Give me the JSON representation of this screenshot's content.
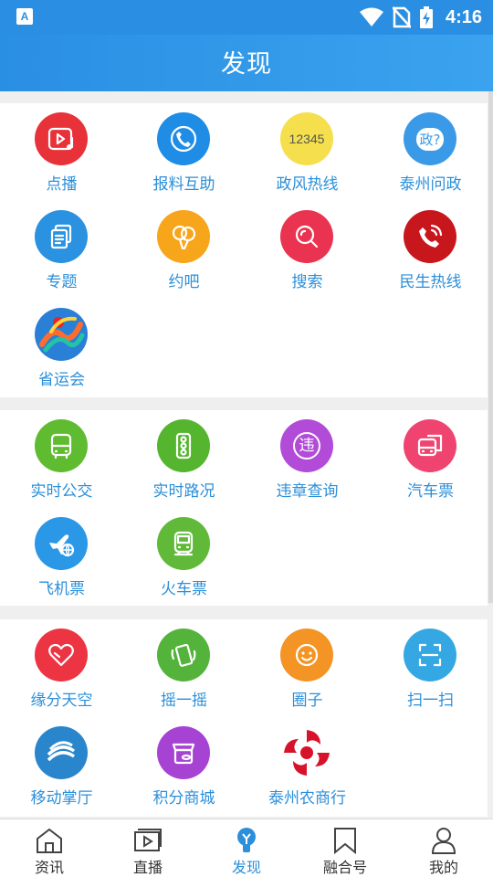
{
  "status_bar": {
    "time": "4:16",
    "app_badge": "A"
  },
  "header": {
    "title": "发现"
  },
  "sections": [
    {
      "items": [
        {
          "label": "点播",
          "icon": "video-music-icon",
          "color": "#e8323a"
        },
        {
          "label": "报料互助",
          "icon": "phone-icon",
          "color": "#1f8de6"
        },
        {
          "label": "政风热线",
          "icon": "hotline-12345-icon",
          "color": "#f5df4d",
          "icon_text": "12345"
        },
        {
          "label": "泰州问政",
          "icon": "inquiry-bubble-icon",
          "color": "#3b9ae8",
          "icon_text": "政?"
        },
        {
          "label": "专题",
          "icon": "topic-docs-icon",
          "color": "#2a92e0"
        },
        {
          "label": "约吧",
          "icon": "balloon-icon",
          "color": "#f7a51a"
        },
        {
          "label": "搜索",
          "icon": "search-icon",
          "color": "#ea3350"
        },
        {
          "label": "民生热线",
          "icon": "phone-ring-icon",
          "color": "#c8161d"
        },
        {
          "label": "省运会",
          "icon": "games-logo-icon",
          "color": "#2a7fd6"
        }
      ]
    },
    {
      "items": [
        {
          "label": "实时公交",
          "icon": "bus-icon",
          "color": "#5fbb2f"
        },
        {
          "label": "实时路况",
          "icon": "traffic-light-icon",
          "color": "#55b52e"
        },
        {
          "label": "违章查询",
          "icon": "violation-search-icon",
          "color": "#b24bd8",
          "icon_text": "违"
        },
        {
          "label": "汽车票",
          "icon": "coach-ticket-icon",
          "color": "#ef4470"
        },
        {
          "label": "飞机票",
          "icon": "airplane-icon",
          "color": "#2a98e6"
        },
        {
          "label": "火车票",
          "icon": "train-icon",
          "color": "#61b93a"
        }
      ]
    },
    {
      "items": [
        {
          "label": "缘分天空",
          "icon": "heart-icon",
          "color": "#ec3442"
        },
        {
          "label": "摇一摇",
          "icon": "shake-phone-icon",
          "color": "#54b33b"
        },
        {
          "label": "圈子",
          "icon": "smile-icon",
          "color": "#f39424"
        },
        {
          "label": "扫一扫",
          "icon": "scan-icon",
          "color": "#35a8e4"
        },
        {
          "label": "移动掌厅",
          "icon": "china-mobile-icon",
          "color": "#2a86cc"
        },
        {
          "label": "积分商城",
          "icon": "shop-icon",
          "color": "#a743d3"
        },
        {
          "label": "泰州农商行",
          "icon": "bank-logo-icon",
          "color": "#ffffff"
        }
      ]
    }
  ],
  "tabs": [
    {
      "label": "资讯",
      "icon": "home-icon",
      "active": false
    },
    {
      "label": "直播",
      "icon": "live-icon",
      "active": false
    },
    {
      "label": "发现",
      "icon": "discover-bulb-icon",
      "active": true
    },
    {
      "label": "融合号",
      "icon": "bookmark-icon",
      "active": false
    },
    {
      "label": "我的",
      "icon": "profile-icon",
      "active": false
    }
  ]
}
